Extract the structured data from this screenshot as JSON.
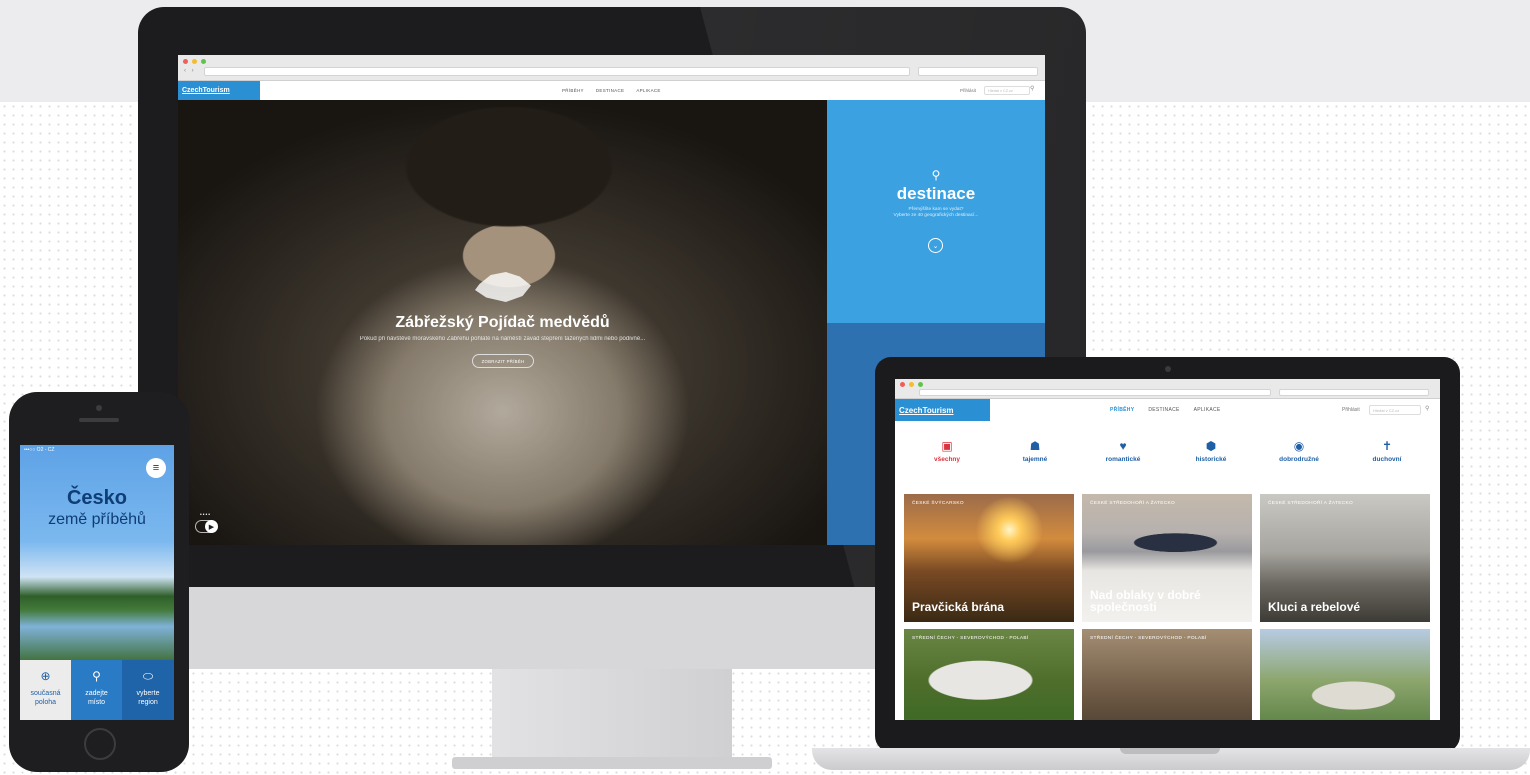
{
  "desktop": {
    "nav": {
      "logo": "CzechTourism",
      "menu": [
        "PŘÍBĚHY",
        "DESTINACE",
        "APLIKACE"
      ],
      "login": "Přihlásit",
      "search_placeholder": "Hledat v CZ.cz"
    },
    "hero": {
      "title": "Zábřežský Pojídač medvědů",
      "text": "Pokud při návštěvě moravského Zábřehu pohlaté na náměstí zavád stepření tažených lidmi nebo podivné...",
      "button": "ZOBRAZIT PŘÍBĚH"
    },
    "destination_panel": {
      "icon": "map-pin-icon",
      "title": "destinace",
      "subtitle_line1": "Přemýšlíte kam se vydat?",
      "subtitle_line2": "Vyberte ze 40 geografických destinací...",
      "down_icon": "chevron-down-icon"
    }
  },
  "laptop": {
    "nav": {
      "logo": "CzechTourism",
      "menu": [
        "PŘÍBĚHY",
        "DESTINACE",
        "APLIKACE"
      ],
      "active_index": 0,
      "login": "Přihlásit",
      "search_placeholder": "Hledat v CZ.cz"
    },
    "categories": [
      {
        "label": "všechny",
        "icon": "inbox-icon",
        "active": true
      },
      {
        "label": "tajemné",
        "icon": "ghost-icon",
        "active": false
      },
      {
        "label": "romantické",
        "icon": "heart-icon",
        "active": false
      },
      {
        "label": "historické",
        "icon": "shield-icon",
        "active": false
      },
      {
        "label": "dobrodružné",
        "icon": "compass-icon",
        "active": false
      },
      {
        "label": "duchovní",
        "icon": "cross-icon",
        "active": false
      }
    ],
    "cards": [
      {
        "region": "ČESKÉ ŠVÝCARSKO",
        "title": "Pravčická brána"
      },
      {
        "region": "ČESKÉ STŘEDOHOŘÍ A ŽATECKO",
        "title": "Nad oblaky v dobré společnosti"
      },
      {
        "region": "ČESKÉ STŘEDOHOŘÍ A ŽATECKO",
        "title": "Kluci a rebelové"
      },
      {
        "region": "STŘEDNÍ ČECHY - SEVEROVÝCHOD - POLABÍ",
        "title": ""
      },
      {
        "region": "STŘEDNÍ ČECHY - SEVEROVÝCHOD - POLABÍ",
        "title": ""
      },
      {
        "region": "",
        "title": ""
      }
    ]
  },
  "phone": {
    "status": "•••○○ O2 - CZ",
    "title": "Česko",
    "subtitle": "země příběhů",
    "tabs": [
      {
        "label_line1": "současná",
        "label_line2": "poloha",
        "icon": "crosshair-icon",
        "color": "#ececec",
        "text_color": "#1f5fa5"
      },
      {
        "label_line1": "zadejte",
        "label_line2": "místo",
        "icon": "map-pin-icon",
        "color": "#2a7bc6",
        "text_color": "#ffffff"
      },
      {
        "label_line1": "vyberte",
        "label_line2": "region",
        "icon": "region-icon",
        "color": "#1f63a8",
        "text_color": "#ffffff"
      }
    ]
  },
  "colors": {
    "brand_blue": "#2b8fd3",
    "accent_red": "#d9343f",
    "category_blue": "#1f5fa5"
  }
}
